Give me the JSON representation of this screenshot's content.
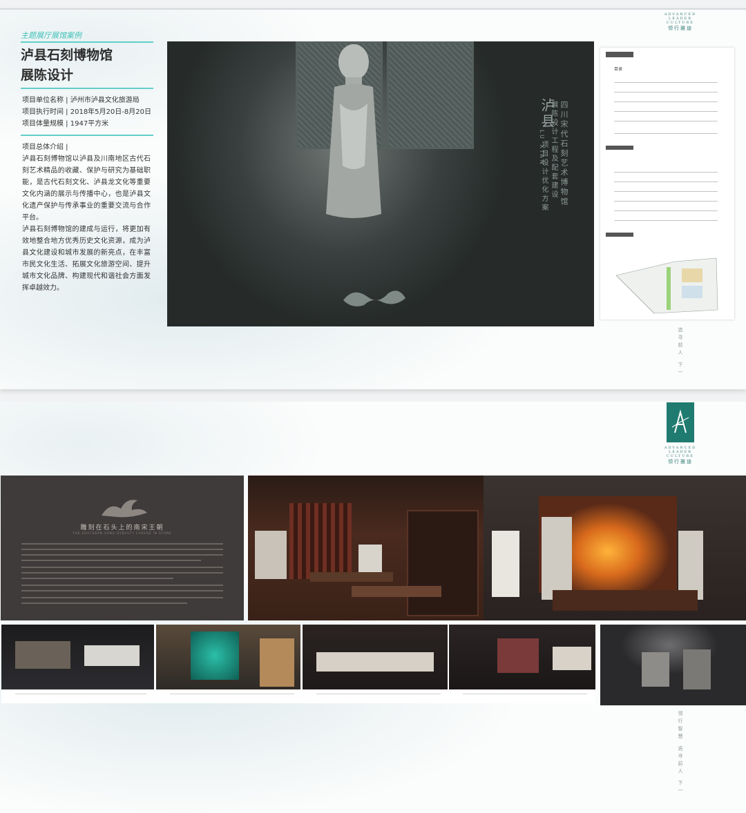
{
  "brand": {
    "en_lines": [
      "ADVANCED",
      "LEADER",
      "CULTURE"
    ],
    "cn": "领行雅迪"
  },
  "slide1": {
    "subtitle": "主题展厅展馆案例",
    "title_line1": "泸县石刻博物馆",
    "title_line2": "展陈设计",
    "info": [
      "项目单位名称 | 泸州市泸县文化旅游局",
      "项目执行时间 | 2018年5月20日-8月20日",
      "项目体量规模 | 1947平方米"
    ],
    "intro_label": "项目总体介绍 |",
    "intro_p1": "泸县石刻博物馆以泸县及川南地区古代石刻艺术精品的收藏、保护与研究为基础职能，是古代石刻文化、泸县龙文化等重要文化内涵的展示与传播中心，也是泸县文化遗产保护与传承事业的重要交流与合作平台。",
    "intro_p2": "泸县石刻博物馆的建成与运行，将更加有效地整合地方优秀历史文化资源，成为泸县文化建设和城市发展的新亮点，在丰富市民文化生活、拓展文化旅游空间、提升城市文化品牌、构建现代和谐社会方面发挥卓越效力。",
    "hero_calligraphy": "泸县",
    "hero_pinyin": "LU XIAN",
    "hero_col1": "四川宋代石刻艺术博物馆",
    "hero_col2": "展陈设计工程及配套建设",
    "hero_col3": "项目设计优化方案",
    "plan_heading": "目录",
    "side_vertical": "追寻前人 下一"
  },
  "slide2": {
    "story_title": "雕刻在石头上的南宋王朝",
    "story_sub": "THE SOUTHERN SONG DYNASTY CARVED IN STONE",
    "side_vertical": "领行智慧 追寻前人 下一"
  }
}
